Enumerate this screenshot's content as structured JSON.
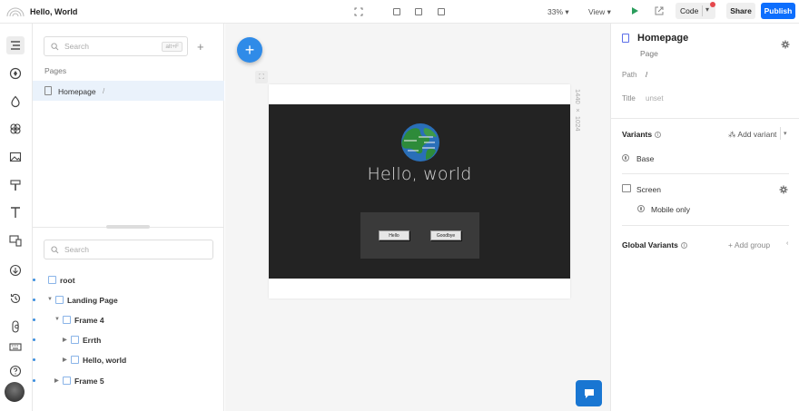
{
  "app": {
    "title": "Hello, World"
  },
  "toolbar": {
    "zoom": "33%",
    "view_label": "View",
    "code_label": "Code",
    "share_label": "Share",
    "publish_label": "Publish",
    "publish_color": "#0d6efd",
    "notification_color": "#e5484d"
  },
  "rail": {
    "items": [
      "pages-icon",
      "components-icon",
      "mixins-icon",
      "tokens-icon",
      "images-icon",
      "themes-icon",
      "fonts-icon",
      "responsive-icon",
      "imports-icon",
      "history-icon",
      "figma-icon",
      "keyboard-icon",
      "help-icon"
    ]
  },
  "left_panel": {
    "search_placeholder": "Search",
    "search_shortcut": "alt+F",
    "pages_heading": "Pages",
    "pages": [
      {
        "name": "Homepage",
        "path": "/"
      }
    ],
    "tree_search_placeholder": "Search",
    "tree": [
      {
        "label": "root"
      },
      {
        "label": "Landing Page"
      },
      {
        "label": "Frame 4"
      },
      {
        "label": "Errth"
      },
      {
        "label": "Hello, world"
      },
      {
        "label": "Frame 5"
      }
    ]
  },
  "canvas": {
    "artboard_size": "1440 × 1024",
    "heading": "Hello, world",
    "buttons": [
      "Hello",
      "Goodbye"
    ],
    "frame_color": "#232323"
  },
  "right_panel": {
    "title": "Homepage",
    "subtitle": "Page",
    "path_label": "Path",
    "path_value": "/",
    "title_label": "Title",
    "title_value": "unset",
    "variants_heading": "Variants",
    "add_variant_label": "Add variant",
    "base_label": "Base",
    "screen_heading": "Screen",
    "screen_value": "Mobile only",
    "global_variants_heading": "Global Variants",
    "add_group_label": "Add group"
  }
}
